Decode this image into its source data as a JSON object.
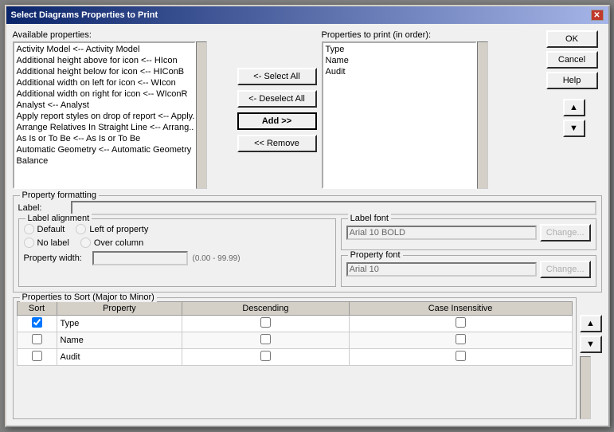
{
  "title": "Select Diagrams Properties to Print",
  "available_properties": {
    "label": "Available properties:",
    "items": [
      "Activity Model <-- Activity Model",
      "Additional height above for icon <-- HIcon",
      "Additional height below for icon <-- HIConB",
      "Additional width on left for icon <-- WIcon",
      "Additional width on right for icon <-- WIconR",
      "Analyst <-- Analyst",
      "Apply report styles on drop of report <-- Apply...",
      "Arrange Relatives In Straight Line <-- Arrang...",
      "As Is or To Be <-- As Is or To Be",
      "Automatic Geometry <-- Automatic Geometry",
      "Balance"
    ]
  },
  "buttons": {
    "select_all": "<- Select All",
    "deselect_all": "<- Deselect All",
    "add": "Add >>",
    "remove": "<< Remove",
    "ok": "OK",
    "cancel": "Cancel",
    "help": "Help",
    "up_arrow": "▲",
    "down_arrow": "▼",
    "sort_up": "▲",
    "sort_down": "▼"
  },
  "properties_to_print": {
    "label": "Properties to print (in order):",
    "items": [
      "Type",
      "Name",
      "Audit"
    ]
  },
  "property_formatting": {
    "group_label": "Property formatting",
    "label_label": "Label:",
    "label_value": "",
    "label_alignment": {
      "group_label": "Label alignment",
      "default": "Default",
      "no_label": "No label",
      "left_of_property": "Left of property",
      "over_column": "Over column"
    },
    "label_font": {
      "group_label": "Label font",
      "value": "Arial 10 BOLD",
      "change_btn": "Change..."
    },
    "property_font": {
      "group_label": "Property font",
      "value": "Arial 10",
      "change_btn": "Change..."
    },
    "property_width_label": "Property width:",
    "property_width_value": "",
    "property_width_hint": "(0.00 - 99.99)"
  },
  "sort_section": {
    "group_label": "Properties to Sort (Major to Minor)",
    "columns": [
      "Sort",
      "Property",
      "Descending",
      "Case Insensitive"
    ],
    "rows": [
      {
        "sort": true,
        "property": "Type",
        "descending": false,
        "case_insensitive": false
      },
      {
        "sort": false,
        "property": "Name",
        "descending": false,
        "case_insensitive": false
      },
      {
        "sort": false,
        "property": "Audit",
        "descending": false,
        "case_insensitive": false
      }
    ]
  }
}
